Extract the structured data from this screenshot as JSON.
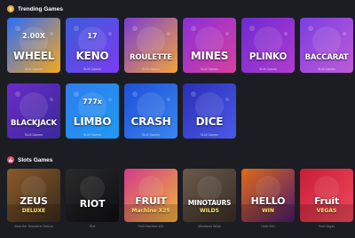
{
  "trending": {
    "title": "Trending Games",
    "icon": "flame-icon",
    "games": [
      {
        "name": "WHEEL",
        "provider": "SLM Games",
        "badge": "2.00X",
        "colors": [
          "#2a6cff",
          "#f7a81b"
        ]
      },
      {
        "name": "KENO",
        "provider": "SLM Games",
        "badge": "17",
        "colors": [
          "#3c5bd9",
          "#7c3df0"
        ]
      },
      {
        "name": "ROULETTE",
        "provider": "SLM Games",
        "colors": [
          "#7a3bd6",
          "#f0a43a"
        ]
      },
      {
        "name": "MINES",
        "provider": "SLM Games",
        "colors": [
          "#8a2fd8",
          "#d9409e"
        ]
      },
      {
        "name": "PLINKO",
        "provider": "SLM Games",
        "colors": [
          "#6e2bd0",
          "#b23ad0"
        ]
      },
      {
        "name": "BACCARAT",
        "provider": "SLM Games",
        "colors": [
          "#7a3fe0",
          "#c05ad8"
        ]
      },
      {
        "name": "BLACKJACK",
        "provider": "SLM Games",
        "colors": [
          "#6a2bc8",
          "#3a2a9a"
        ]
      },
      {
        "name": "LIMBO",
        "provider": "SLM Games",
        "badge": "777x",
        "colors": [
          "#2f7cf0",
          "#1f9af0"
        ]
      },
      {
        "name": "CRASH",
        "provider": "SLM Games",
        "colors": [
          "#1e4fd8",
          "#3a86f0"
        ]
      },
      {
        "name": "DICE",
        "provider": "SLM Games",
        "colors": [
          "#2a2fb8",
          "#4a5ae8"
        ]
      }
    ]
  },
  "slots": {
    "title": "Slots Games",
    "icon": "cherry-icon",
    "games": [
      {
        "name": "ZEUS",
        "sub": "DELUXE",
        "caption": "Zeus the Thunderer Deluxe",
        "colors": [
          "#8a5a2a",
          "#3a2a1a"
        ]
      },
      {
        "name": "RIOT",
        "caption": "Riot",
        "colors": [
          "#2a2a2a",
          "#0f0f12"
        ]
      },
      {
        "name": "FRUIT",
        "sub": "Machine X25",
        "caption": "Fruit Machine x25",
        "colors": [
          "#d23a8a",
          "#f0b43a"
        ]
      },
      {
        "name": "MINOTAURS",
        "sub": "WILDS",
        "caption": "Minotaurs Wilds",
        "colors": [
          "#6a5a4a",
          "#3a2e26"
        ]
      },
      {
        "name": "HELLO",
        "sub": "WIN",
        "caption": "Hello Win",
        "colors": [
          "#e06a1a",
          "#4a1a6a"
        ]
      },
      {
        "name": "Fruit",
        "sub": "VEGAS",
        "caption": "Fruit Vegas",
        "colors": [
          "#c81e3a",
          "#f04a5a"
        ]
      }
    ]
  }
}
